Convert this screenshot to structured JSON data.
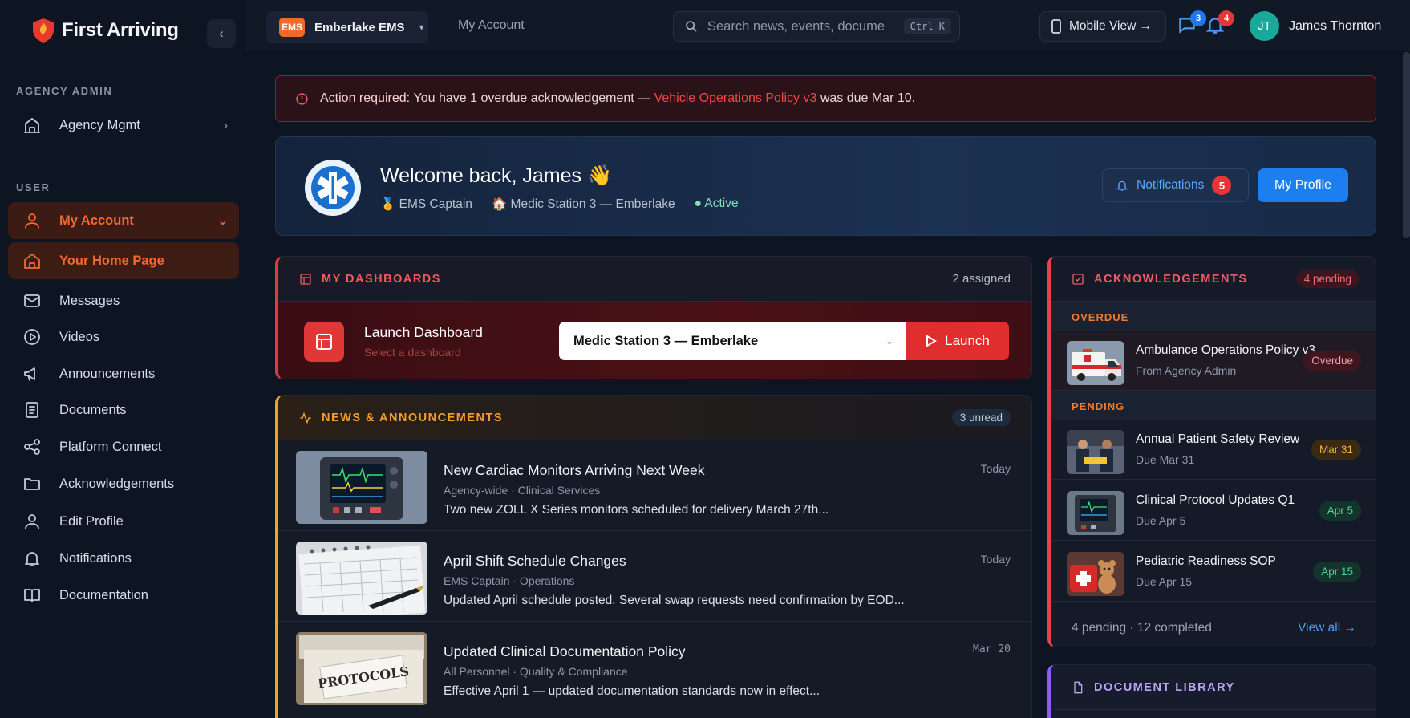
{
  "brand": {
    "name": "First Arriving"
  },
  "sidebar": {
    "agency_section": "AGENCY ADMIN",
    "agency_item": "Agency Mgmt",
    "user_section": "USER",
    "items": [
      {
        "label": "My Account",
        "icon": "user-icon",
        "active": true
      },
      {
        "label": "Your Home Page",
        "icon": "home-icon",
        "active": true
      },
      {
        "label": "Messages",
        "icon": "mail-icon"
      },
      {
        "label": "Videos",
        "icon": "play-icon"
      },
      {
        "label": "Announcements",
        "icon": "megaphone-icon"
      },
      {
        "label": "Documents",
        "icon": "document-icon"
      },
      {
        "label": "Platform Connect",
        "icon": "share-icon"
      },
      {
        "label": "Acknowledgements",
        "icon": "folder-icon"
      },
      {
        "label": "Edit Profile",
        "icon": "user-icon"
      },
      {
        "label": "Notifications",
        "icon": "bell-icon"
      },
      {
        "label": "Documentation",
        "icon": "book-icon"
      }
    ]
  },
  "topbar": {
    "org_badge": "EMS",
    "org_name": "Emberlake EMS",
    "account_link": "My Account",
    "search_placeholder": "Search news, events, docume",
    "search_shortcut": "Ctrl K",
    "mobile_view": "Mobile View →",
    "messages_count": "3",
    "notifications_count": "4",
    "user_initials": "JT",
    "user_name": "James Thornton"
  },
  "alert": {
    "label": "Action required:",
    "text": "You have 1 overdue acknowledgement —",
    "policy": "Vehicle Operations Policy v3",
    "due": "was due Mar 10."
  },
  "welcome": {
    "title": "Welcome back, James 👋",
    "role": "🏅 EMS Captain",
    "station": "🏠 Medic Station 3 — Emberlake",
    "status": "● Active",
    "notifications_label": "Notifications",
    "notifications_count": "5",
    "profile_label": "My Profile"
  },
  "dashboards": {
    "heading": "MY DASHBOARDS",
    "assigned": "2 assigned",
    "launch_title": "Launch Dashboard",
    "launch_hint": "Select a dashboard",
    "selected": "Medic Station 3 — Emberlake",
    "launch_button": "Launch"
  },
  "news": {
    "heading": "NEWS & ANNOUNCEMENTS",
    "unread": "3 unread",
    "items": [
      {
        "title": "New Cardiac Monitors Arriving Next Week",
        "meta": "Agency-wide · Clinical Services",
        "excerpt": "Two new ZOLL X Series monitors scheduled for delivery March 27th...",
        "date": "Today"
      },
      {
        "title": "April Shift Schedule Changes",
        "meta": "EMS Captain · Operations",
        "excerpt": "Updated April schedule posted. Several swap requests need confirmation by EOD...",
        "date": "Today"
      },
      {
        "title": "Updated Clinical Documentation Policy",
        "meta": "All Personnel · Quality & Compliance",
        "excerpt": "Effective April 1 — updated documentation standards now in effect...",
        "date": "Mar 20"
      }
    ]
  },
  "acknowledgements": {
    "heading": "ACKNOWLEDGEMENTS",
    "pending_pill": "4 pending",
    "overdue_label": "OVERDUE",
    "pending_label": "PENDING",
    "items": [
      {
        "title": "Ambulance Operations Policy v3",
        "sub": "From Agency Admin",
        "tag": "Overdue"
      },
      {
        "title": "Annual Patient Safety Review",
        "sub": "Due Mar 31",
        "tag": "Mar 31"
      },
      {
        "title": "Clinical Protocol Updates Q1",
        "sub": "Due Apr 5",
        "tag": "Apr 5"
      },
      {
        "title": "Pediatric Readiness SOP",
        "sub": "Due Apr 15",
        "tag": "Apr 15"
      }
    ],
    "footer": "4 pending · 12 completed",
    "view_all": "View all →"
  },
  "document_library": {
    "heading": "DOCUMENT LIBRARY"
  },
  "colors": {
    "accent": "#f4682f",
    "danger": "#e13a3a",
    "primary": "#1d7ef0",
    "news": "#f0a02a"
  }
}
